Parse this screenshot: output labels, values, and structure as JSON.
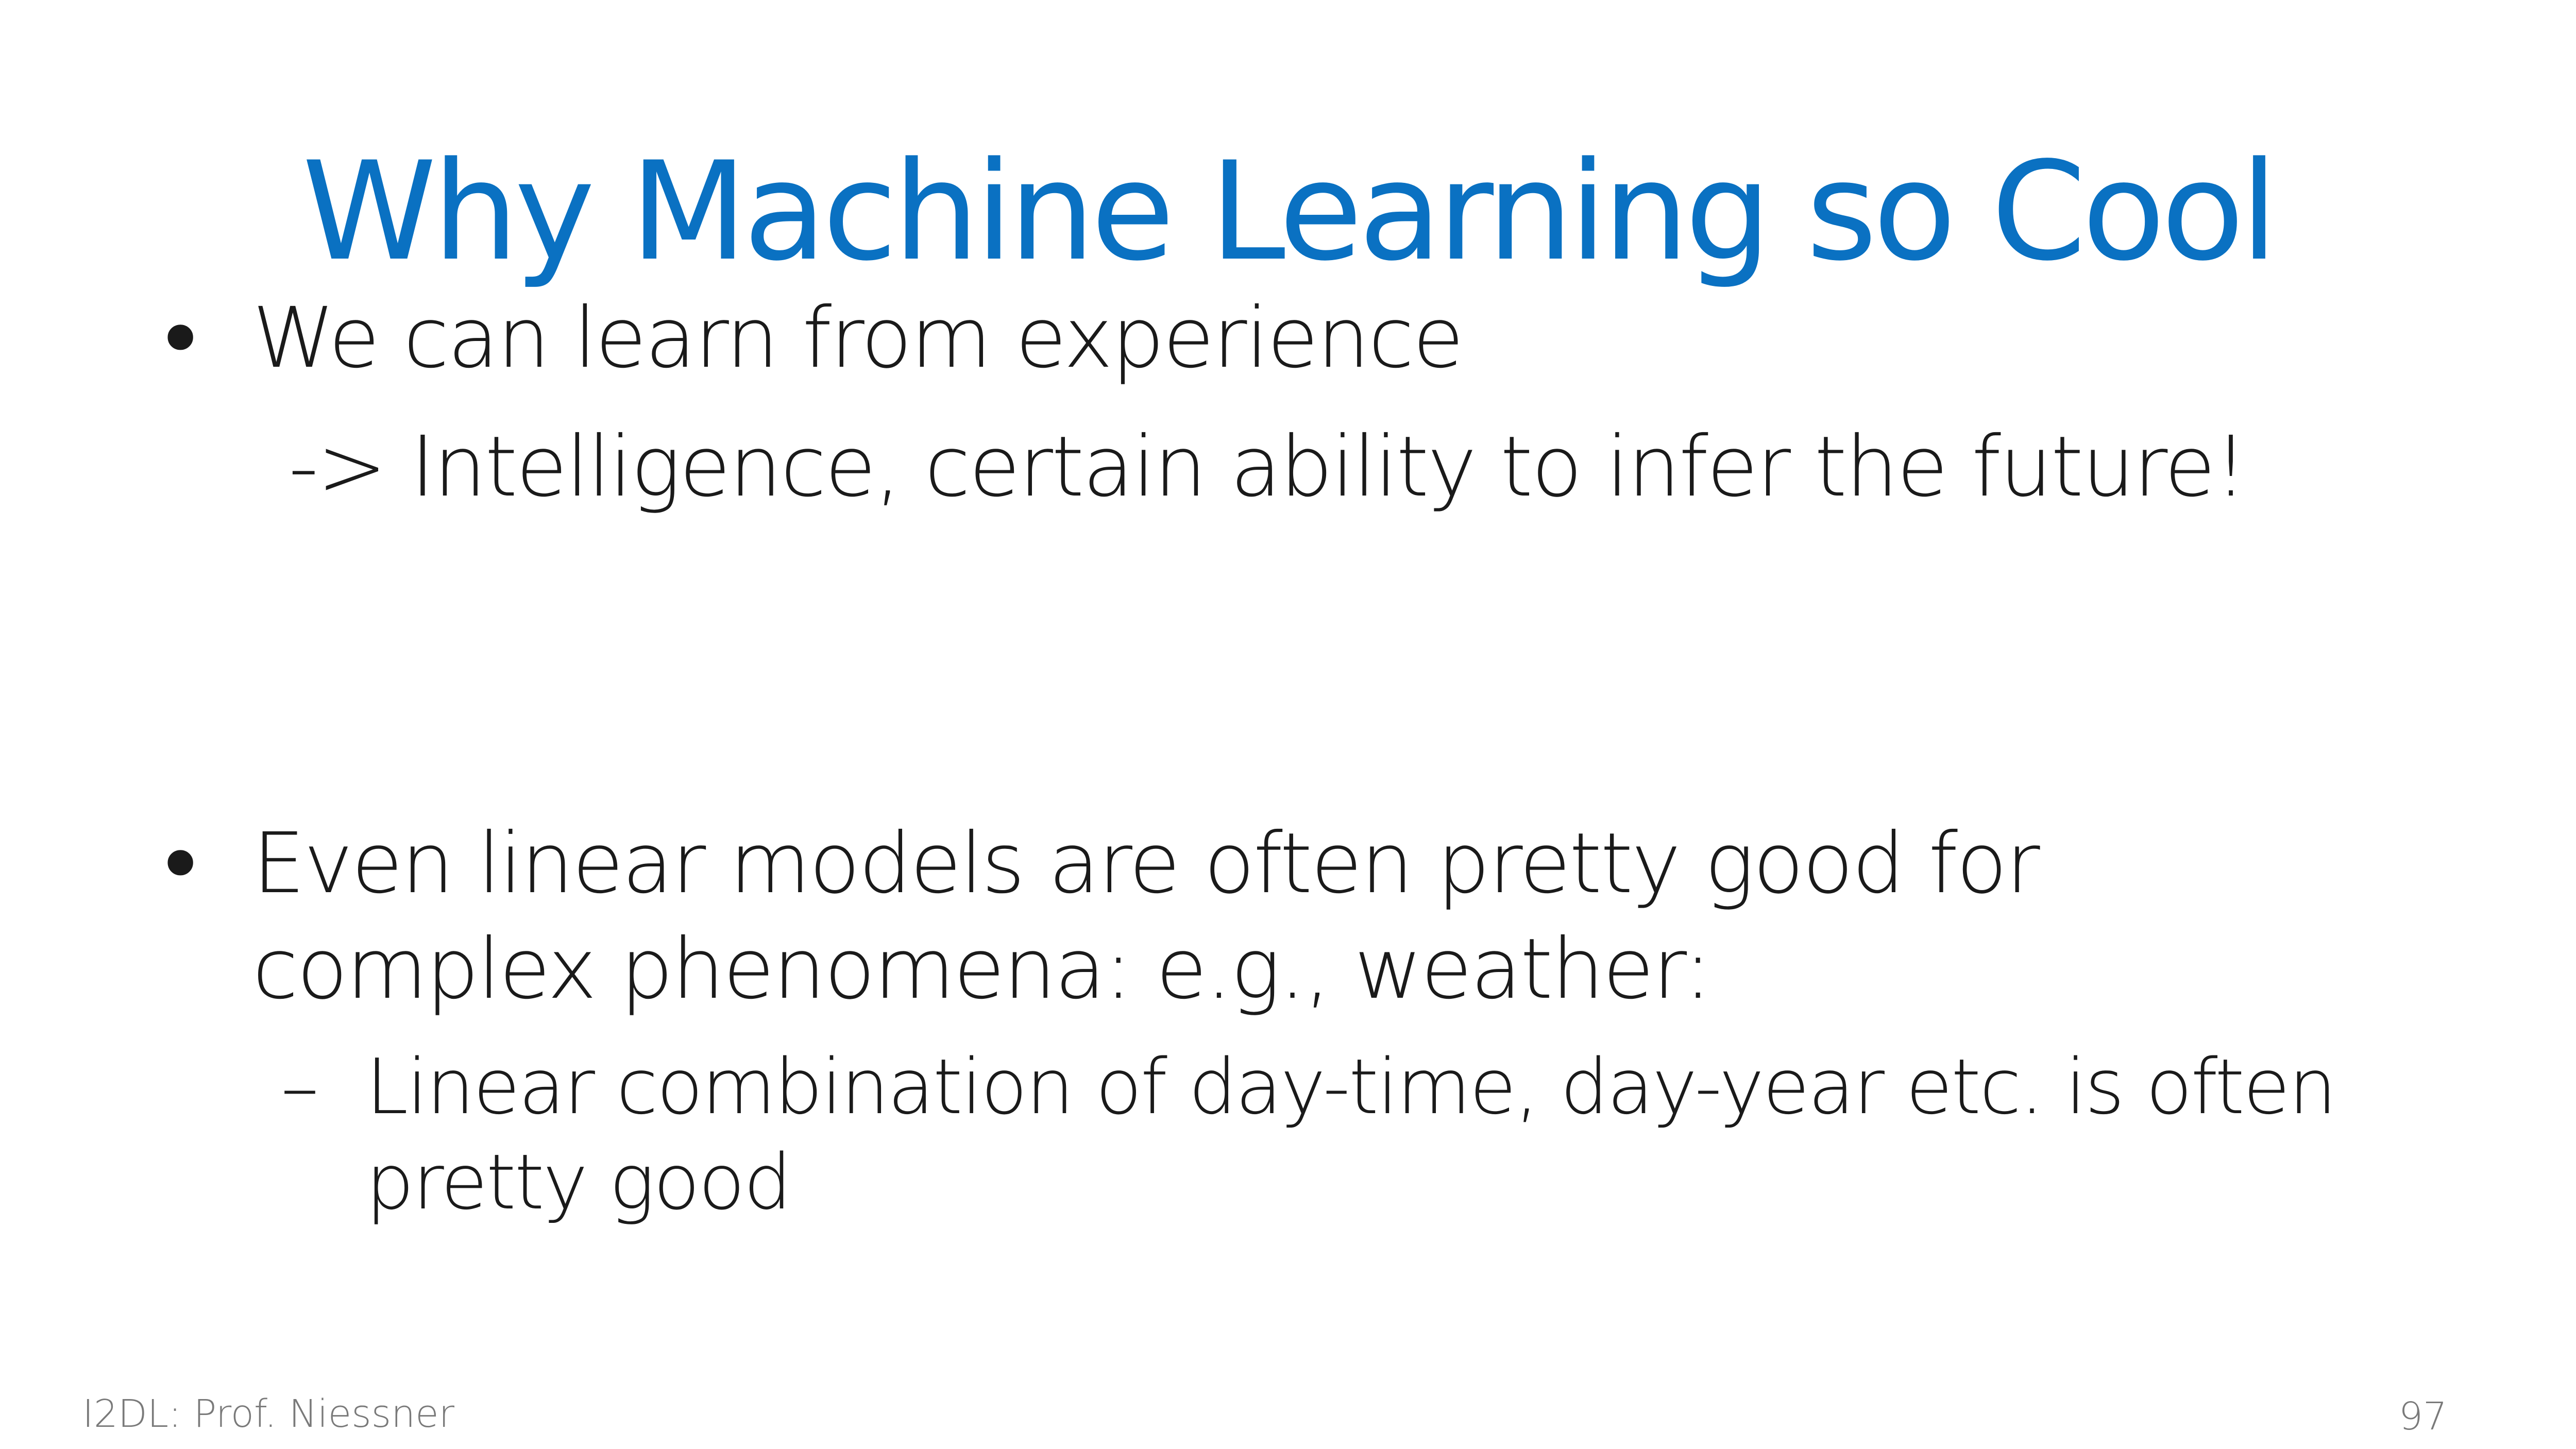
{
  "theme": {
    "accent": "#0a71c2"
  },
  "slide": {
    "title": "Why Machine Learning so Cool",
    "bullets": [
      {
        "lines": [
          "We can learn from experience"
        ],
        "continuation": "-> Intelligence, certain ability to infer the future!"
      },
      {
        "lines": [
          "Even linear models are often pretty good for",
          "complex phenomena: e.g., weather:"
        ],
        "sub": {
          "marker": "–",
          "lines": [
            "Linear combination of day-time, day-year etc. is often",
            "pretty good"
          ]
        }
      }
    ],
    "bullet_marker": "•"
  },
  "footer": {
    "left": "I2DL: Prof. Niessner",
    "page_number": "97"
  }
}
